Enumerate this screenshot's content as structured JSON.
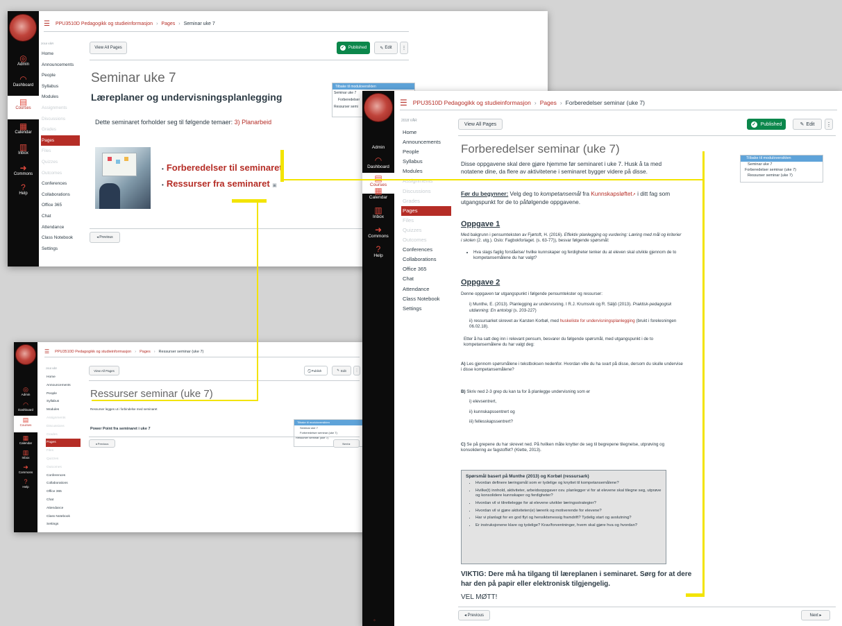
{
  "course": "PPU3510D Pedagogikk og studieinformasjon",
  "breadcrumb_pages": "Pages",
  "global_nav": {
    "admin": "Admin",
    "dashboard": "Dashboard",
    "courses": "Courses",
    "calendar": "Calendar",
    "inbox": "Inbox",
    "commons": "Commons",
    "help": "Help"
  },
  "course_nav": {
    "term": "2018 VÅR",
    "items": [
      "Home",
      "Announcements",
      "People",
      "Syllabus",
      "Modules",
      "Assignments",
      "Discussions",
      "Grades",
      "Pages",
      "Files",
      "Quizzes",
      "Outcomes",
      "Conferences",
      "Collaborations",
      "Office 365",
      "Chat",
      "Attendance",
      "Class Notebook",
      "Settings"
    ]
  },
  "buttons": {
    "view_all_pages": "View All Pages",
    "published": "Published",
    "publish": "Publish",
    "edit": "Edit",
    "more": "⋮",
    "previous": "◂ Previous",
    "next": "Next ▸"
  },
  "module_box": {
    "header": "Tilbake til moduloversikten",
    "seminar7": "Seminar uke 7",
    "forberedelser": "Forberedelser seminar (uke 7)",
    "ressurser": "Ressurser seminar (uke 7)"
  },
  "win1": {
    "crumb_current": "Seminar uke 7",
    "title": "Seminar uke 7",
    "heading": "Læreplaner og undervisningsplanlegging",
    "intro": "Dette seminaret forholder seg til følgende temaer:",
    "intro_link": "3) Planarbeid",
    "link1": "Forberedelser til seminaret",
    "link2": "Ressurser fra seminaret",
    "module_label_1": "Seminar uke 7",
    "module_label_2": "Forberedelser",
    "module_label_3": "Ressurser semi"
  },
  "win2": {
    "crumb_current": "Forberedelser seminar (uke 7)",
    "title": "Forberedelser seminar (uke 7)",
    "intro": "Disse oppgavene skal dere gjøre hjemme før seminaret i uke 7. Husk å ta med notatene dine, da flere av aktivitetene i seminaret bygger videre på disse.",
    "before_label": "Før du begynner:",
    "before_text_1": "Velg deg to",
    "before_italic": "kompetansemål",
    "before_text_2": "fra",
    "before_link": "Kunnskapsløftet",
    "before_text_3": "i ditt fag som utgangspunkt for de to påfølgende oppgavene.",
    "oppgave1": "Oppgave 1",
    "o1_text_1": "Med bakgrunn i pensumteksten av Fjørtoft, H. (2016).",
    "o1_italic": "Effektiv planlegging og vurdering: Læring med mål og kriterier i skolen",
    "o1_text_2": "(2. utg.). Oslo: Fagbokforlaget. (s. 63-77)), besvar følgende spørsmål:",
    "o1_bullet": "Hva slags faglig forståelse/ hvilke kunnskaper og ferdigheter tenker du at eleven skal utvikle gjennom de to kompetansemålene du har valgt?",
    "oppgave2": "Oppgave 2",
    "o2_intro": "Denne oppgaven tar utgangspunkt i følgende pensumtekster og ressurser:",
    "o2_i_1": "i) Munthe, E. (2013). Planlegging av undervisning. I R.J. Krumsvik og R. Säljö (2013).",
    "o2_i_italic": "Praktisk-pedagogisk utdanning: En antologi",
    "o2_i_2": "(s. 203-227)",
    "o2_ii_1": "ii) ressursarket skrevet av Karsten Korbøl, med",
    "o2_ii_link": "huskeliste for undervisningsplanlegging",
    "o2_ii_2": "(brukt i forelesningen 06.02.18).",
    "o2_after": "Etter å ha satt deg inn i relevant pensum, besvarer du følgende spørsmål, med utgangspunkt i de to kompetansemålene du har valgt deg:",
    "qa_label": "A)",
    "qa": "Les gjennom spørsmålene i tekstboksen nedenfor. Hvordan ville du ha svart på disse, dersom du skulle undervise i disse kompetansemålene?",
    "qb_label": "B)",
    "qb": "Skriv ned 2-3 grep du kan ta for å planlegge undervisning som er",
    "qb_i": "i) elevsentrert,",
    "qb_ii": "ii) kunnskapssentrert og",
    "qb_iii": "iii) fellesskapssentrert?",
    "qc_label": "C)",
    "qc": "Se på grepene du har skrevet ned. På hvilken måte knytter de seg til begrepene tilegnelse, utprøving og konsolidering av fagstoffet? (Klette, 2013).",
    "box_title": "Spørsmål basert på Munthe (2013) og Korbøl (ressursark)",
    "box_items": [
      "Hvordan definere læringsmål som er tydelige og knyttet til kompetansemålene?",
      "Hvilke(t) innhold, aktiviteter, arbeidsoppgaver osv. planlegger vi for at elevene skal tilegne seg, utprøve og konsolidere kunnskaper og ferdigheter?",
      "Hvordan vil vi tilrettelegge for at elevene utvikler læringsstrategier?",
      "Hvordan vil vi gjøre aktiviteten(e) lærerik og motiverende for elevene?",
      "Har vi planlagt for en god flyt og hensiktsmessig framdrift? Tydelig start og avslutning?",
      "Er instruksjonene klare og tydelige? Krav/forventninger, hvem skal gjøre hva og hvordan?"
    ],
    "viktig": "VIKTIG: Dere må ha tilgang til læreplanen i seminaret. Sørg for at dere har den på papir eller elektronisk tilgjengelig.",
    "velmott": "VEL MØTT!"
  },
  "win3": {
    "crumb_current": "Ressurser seminar (uke 7)",
    "title": "Ressurser seminar (uke 7)",
    "intro": "Ressurser legges ut i forbindelse med seminaret",
    "link": "Power Point fra seminaret i uke 7"
  },
  "colors": {
    "accent": "#b52d26",
    "published": "#0b874b",
    "highlight": "#f3e400",
    "module_header": "#5ea3d9"
  }
}
